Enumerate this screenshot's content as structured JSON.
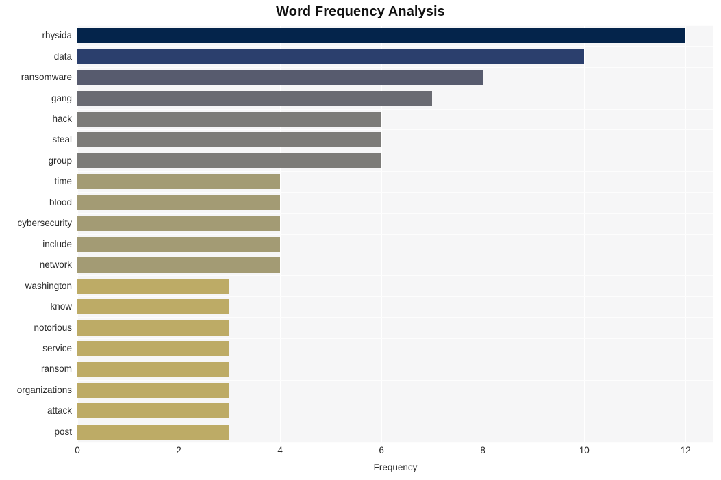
{
  "chart_data": {
    "type": "bar",
    "orientation": "horizontal",
    "title": "Word Frequency Analysis",
    "xlabel": "Frequency",
    "ylabel": "",
    "xlim": [
      0,
      12.55
    ],
    "xticks": [
      0,
      2,
      4,
      6,
      8,
      10,
      12
    ],
    "xtick_labels": [
      "0",
      "2",
      "4",
      "6",
      "8",
      "10",
      "12"
    ],
    "grid": true,
    "legend": null,
    "categories": [
      "rhysida",
      "data",
      "ransomware",
      "gang",
      "hack",
      "steal",
      "group",
      "time",
      "blood",
      "cybersecurity",
      "include",
      "network",
      "washington",
      "know",
      "notorious",
      "service",
      "ransom",
      "organizations",
      "attack",
      "post"
    ],
    "values": [
      12,
      10,
      8,
      7,
      6,
      6,
      6,
      4,
      4,
      4,
      4,
      4,
      3,
      3,
      3,
      3,
      3,
      3,
      3,
      3
    ],
    "bar_colors": [
      "#04244b",
      "#2b3f6d",
      "#575b6e",
      "#6a6b72",
      "#7c7b78",
      "#7c7b78",
      "#7c7b78",
      "#a39b74",
      "#a39b74",
      "#a39b74",
      "#a39b74",
      "#a39b74",
      "#bdab66",
      "#bdab66",
      "#bdab66",
      "#bdab66",
      "#bdab66",
      "#bdab66",
      "#bdab66",
      "#bdab66"
    ]
  },
  "style": {
    "plot_background": "#f6f6f7",
    "page_background": "#ffffff",
    "gridline_color": "#ffffff",
    "text_color": "#2b2b2b",
    "title_color": "#111111"
  }
}
